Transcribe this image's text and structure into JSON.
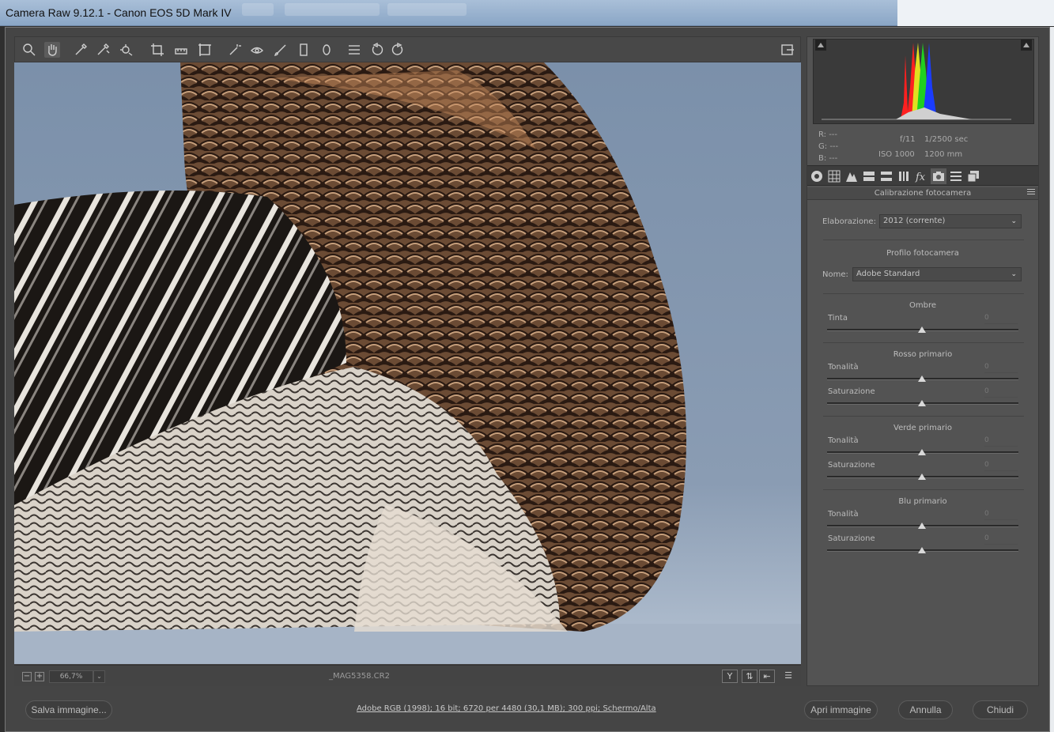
{
  "window": {
    "title": "Camera Raw 9.12.1  -  Canon EOS 5D Mark IV"
  },
  "toolbar": {
    "tools": [
      {
        "name": "zoom-tool-icon"
      },
      {
        "name": "hand-tool-icon"
      },
      {
        "name": "white-balance-icon"
      },
      {
        "name": "color-sampler-icon"
      },
      {
        "name": "targeted-adjustment-icon"
      },
      {
        "name": "crop-tool-icon"
      },
      {
        "name": "straighten-tool-icon"
      },
      {
        "name": "transform-tool-icon"
      },
      {
        "name": "spot-removal-icon"
      },
      {
        "name": "red-eye-icon"
      },
      {
        "name": "adjustment-brush-icon"
      },
      {
        "name": "graduated-filter-icon"
      },
      {
        "name": "radial-filter-icon"
      },
      {
        "name": "preferences-icon"
      },
      {
        "name": "rotate-left-icon"
      },
      {
        "name": "rotate-right-icon"
      }
    ]
  },
  "histogram": {
    "r": "R:",
    "g": "G:",
    "b": "B:",
    "r_val": "---",
    "g_val": "---",
    "b_val": "---",
    "aperture": "f/11",
    "shutter": "1/2500 sec",
    "iso": "ISO 1000",
    "focal": "1200 mm"
  },
  "panel": {
    "title": "Calibrazione fotocamera",
    "process_label": "Elaborazione:",
    "process_value": "2012 (corrente)",
    "profile_title": "Profilo fotocamera",
    "name_label": "Nome:",
    "name_value": "Adobe Standard",
    "sections": [
      {
        "title": "Ombre",
        "sliders": [
          {
            "label": "Tinta",
            "value": "0"
          }
        ]
      },
      {
        "title": "Rosso primario",
        "sliders": [
          {
            "label": "Tonalità",
            "value": "0"
          },
          {
            "label": "Saturazione",
            "value": "0"
          }
        ]
      },
      {
        "title": "Verde primario",
        "sliders": [
          {
            "label": "Tonalità",
            "value": "0"
          },
          {
            "label": "Saturazione",
            "value": "0"
          }
        ]
      },
      {
        "title": "Blu primario",
        "sliders": [
          {
            "label": "Tonalità",
            "value": "0"
          },
          {
            "label": "Saturazione",
            "value": "0"
          }
        ]
      }
    ]
  },
  "status": {
    "zoom": "66,7%",
    "zoom_minus": "−",
    "zoom_plus": "+",
    "zoom_drop": "⌄",
    "filename": "_MAG5358.CR2",
    "view_btn_1": "Y",
    "view_btn_2": "⇅",
    "view_btn_3": "⇤",
    "view_btn_4": "☰"
  },
  "bottom": {
    "save": "Salva immagine...",
    "workflow": "Adobe RGB (1998); 16 bit; 6720 per 4480 (30,1 MB); 300 ppi; Schermo/Alta",
    "open": "Apri immagine",
    "cancel": "Annulla",
    "close": "Chiudi"
  },
  "colors": {
    "preview_sky": "#7f93ab",
    "panel_bg": "#535353"
  }
}
